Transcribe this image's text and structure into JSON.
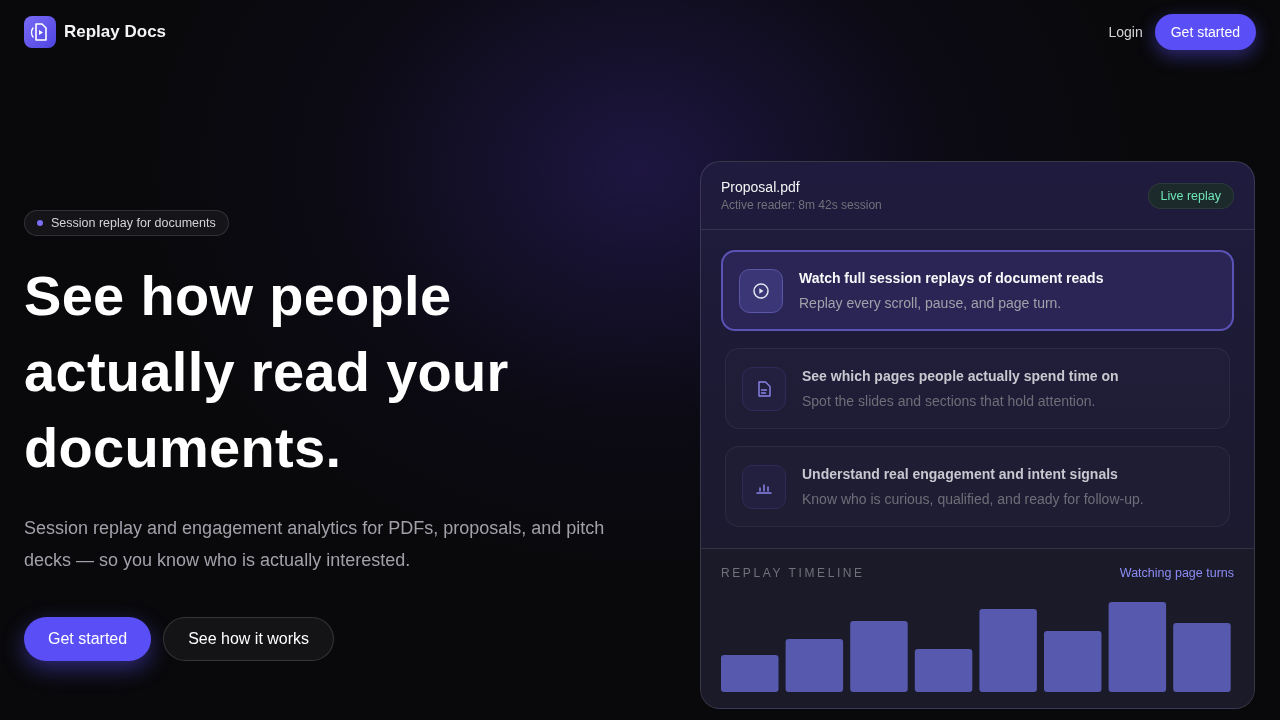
{
  "header": {
    "brand": "Replay Docs",
    "links": [
      {
        "label": "Login",
        "kind": "link"
      },
      {
        "label": "Get started",
        "kind": "button"
      }
    ]
  },
  "hero": {
    "badge": "Session replay for documents",
    "heading": "See how people actually read your documents.",
    "description": "Session replay and engagement analytics for PDFs, proposals, and pitch decks — so you know who is actually interested.",
    "buttons": [
      {
        "label": "Get started",
        "kind": "primary"
      },
      {
        "label": "See how it works",
        "kind": "secondary"
      }
    ]
  },
  "preview": {
    "file_name": "Proposal.pdf",
    "subtitle": "Active reader: 8m 42s session",
    "status": "Live replay",
    "features": [
      {
        "title": "Watch full session replays of document reads",
        "description": "Replay every scroll, pause, and page turn.",
        "selected": true
      },
      {
        "title": "See which pages people actually spend time on",
        "description": "Spot the slides and sections that hold attention.",
        "selected": false
      },
      {
        "title": "Understand real engagement and intent signals",
        "description": "Know who is curious, qualified, and ready for follow-up.",
        "selected": false
      }
    ],
    "timeline": {
      "title": "REPLAY TIMELINE",
      "status": "Watching page turns"
    }
  }
}
